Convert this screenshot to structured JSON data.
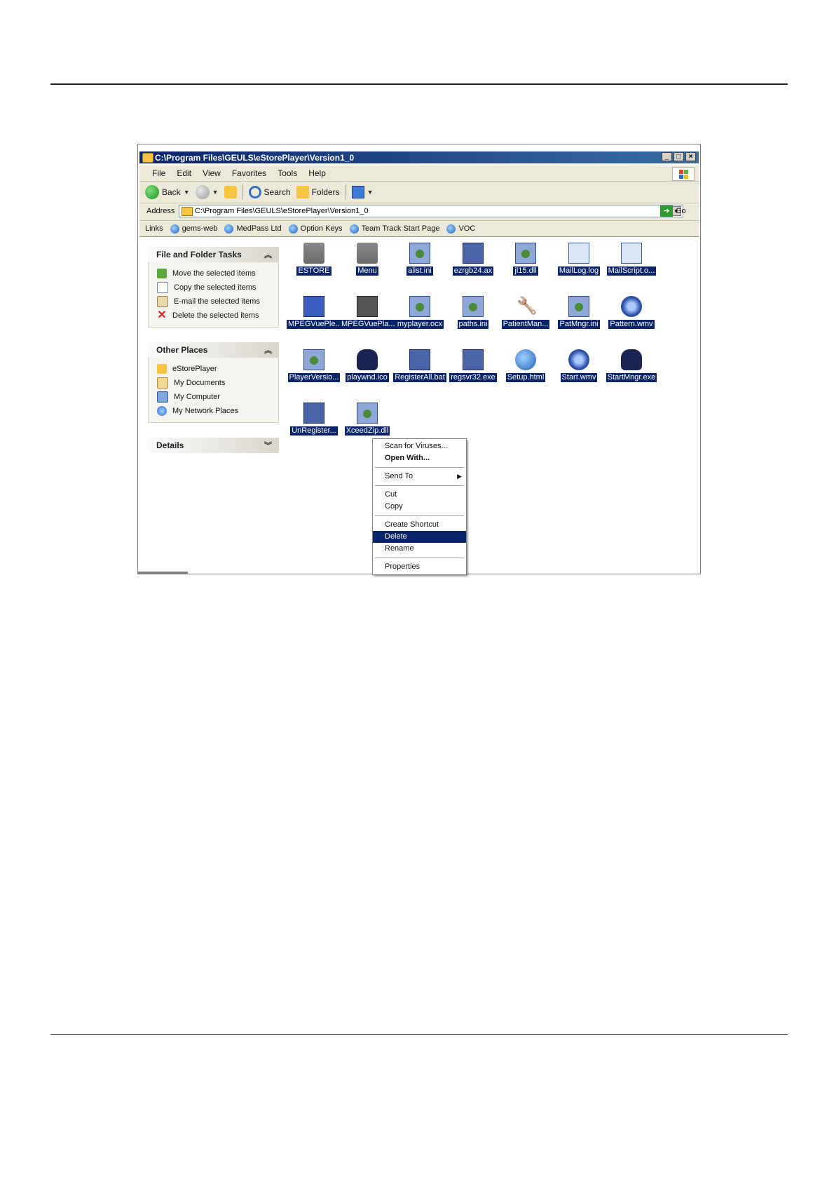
{
  "window": {
    "title": "C:\\Program Files\\GEULS\\eStorePlayer\\Version1_0",
    "buttons": {
      "minimize": "_",
      "maximize": "□",
      "close": "×"
    }
  },
  "menubar": {
    "items": [
      "File",
      "Edit",
      "View",
      "Favorites",
      "Tools",
      "Help"
    ]
  },
  "toolbar": {
    "back": "Back",
    "search": "Search",
    "folders": "Folders"
  },
  "address": {
    "label": "Address",
    "value": "C:\\Program Files\\GEULS\\eStorePlayer\\Version1_0",
    "go": "Go"
  },
  "links": {
    "label": "Links",
    "items": [
      "gems-web",
      "MedPass Ltd",
      "Option Keys",
      "Team Track Start Page",
      "VOC"
    ]
  },
  "panels": {
    "tasks": {
      "title": "File and Folder Tasks",
      "items": [
        "Move the selected items",
        "Copy the selected items",
        "E-mail the selected items",
        "Delete the selected items"
      ]
    },
    "places": {
      "title": "Other Places",
      "items": [
        "eStorePlayer",
        "My Documents",
        "My Computer",
        "My Network Places"
      ]
    },
    "details": {
      "title": "Details"
    }
  },
  "files": [
    {
      "name": "ESTORE",
      "icon": "folder-icon"
    },
    {
      "name": "Menu",
      "icon": "folder-icon"
    },
    {
      "name": "alist.ini",
      "icon": "config-file-icon"
    },
    {
      "name": "ezrgb24.ax",
      "icon": "app-file-icon"
    },
    {
      "name": "jl15.dll",
      "icon": "dll-file-icon"
    },
    {
      "name": "MailLog.log",
      "icon": "text-file-icon"
    },
    {
      "name": "MailScript.o...",
      "icon": "text-file-icon"
    },
    {
      "name": "MPEGVuePle...",
      "icon": "mpeg-app-icon"
    },
    {
      "name": "MPEGVuePla...",
      "icon": "mpeg-file-icon"
    },
    {
      "name": "myplayer.ocx",
      "icon": "config-file-icon"
    },
    {
      "name": "paths.ini",
      "icon": "config-file-icon"
    },
    {
      "name": "PatientMan...",
      "icon": "wrench-icon"
    },
    {
      "name": "PatMngr.ini",
      "icon": "config-file-icon"
    },
    {
      "name": "Pattern.wmv",
      "icon": "media-file-icon"
    },
    {
      "name": "PlayerVersio...",
      "icon": "config-file-icon"
    },
    {
      "name": "playwnd.ico",
      "icon": "ico-file-icon"
    },
    {
      "name": "RegisterAll.bat",
      "icon": "batch-file-icon"
    },
    {
      "name": "regsvr32.exe",
      "icon": "exe-file-icon"
    },
    {
      "name": "Setup.html",
      "icon": "ie-file-icon"
    },
    {
      "name": "Start.wmv",
      "icon": "media-file-icon"
    },
    {
      "name": "StartMngr.exe",
      "icon": "exe-file-icon"
    },
    {
      "name": "UnRegister...",
      "icon": "batch-file-icon"
    },
    {
      "name": "XceedZip.dll",
      "icon": "dll-file-icon"
    }
  ],
  "context_menu": {
    "items": [
      "Scan for Viruses...",
      "Open With...",
      "Send To",
      "Cut",
      "Copy",
      "Create Shortcut",
      "Delete",
      "Rename",
      "Properties"
    ],
    "highlighted": "Delete"
  }
}
